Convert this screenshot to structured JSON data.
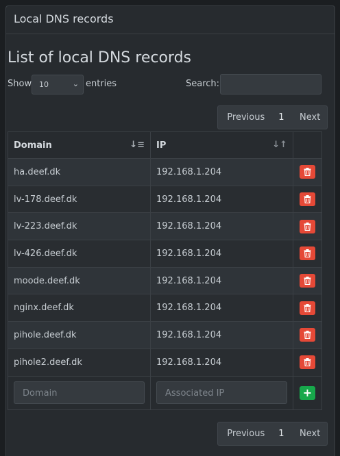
{
  "panel": {
    "title": "Local DNS records"
  },
  "section": {
    "heading": "List of local DNS records"
  },
  "controls": {
    "show_label": "Show",
    "page_length": "10",
    "entries_label": "entries",
    "search_label": "Search:"
  },
  "pagination": {
    "previous": "Previous",
    "current": "1",
    "next": "Next"
  },
  "table": {
    "headers": {
      "domain": "Domain",
      "ip": "IP"
    },
    "rows": [
      {
        "domain": "ha.deef.dk",
        "ip": "192.168.1.204"
      },
      {
        "domain": "lv-178.deef.dk",
        "ip": "192.168.1.204"
      },
      {
        "domain": "lv-223.deef.dk",
        "ip": "192.168.1.204"
      },
      {
        "domain": "lv-426.deef.dk",
        "ip": "192.168.1.204"
      },
      {
        "domain": "moode.deef.dk",
        "ip": "192.168.1.204"
      },
      {
        "domain": "nginx.deef.dk",
        "ip": "192.168.1.204"
      },
      {
        "domain": "pihole.deef.dk",
        "ip": "192.168.1.204"
      },
      {
        "domain": "pihole2.deef.dk",
        "ip": "192.168.1.204"
      }
    ],
    "add_row": {
      "domain_placeholder": "Domain",
      "ip_placeholder": "Associated IP",
      "add_label": "+"
    }
  },
  "colors": {
    "delete": "#e54937",
    "add": "#17a84b",
    "background": "#272b2f"
  }
}
